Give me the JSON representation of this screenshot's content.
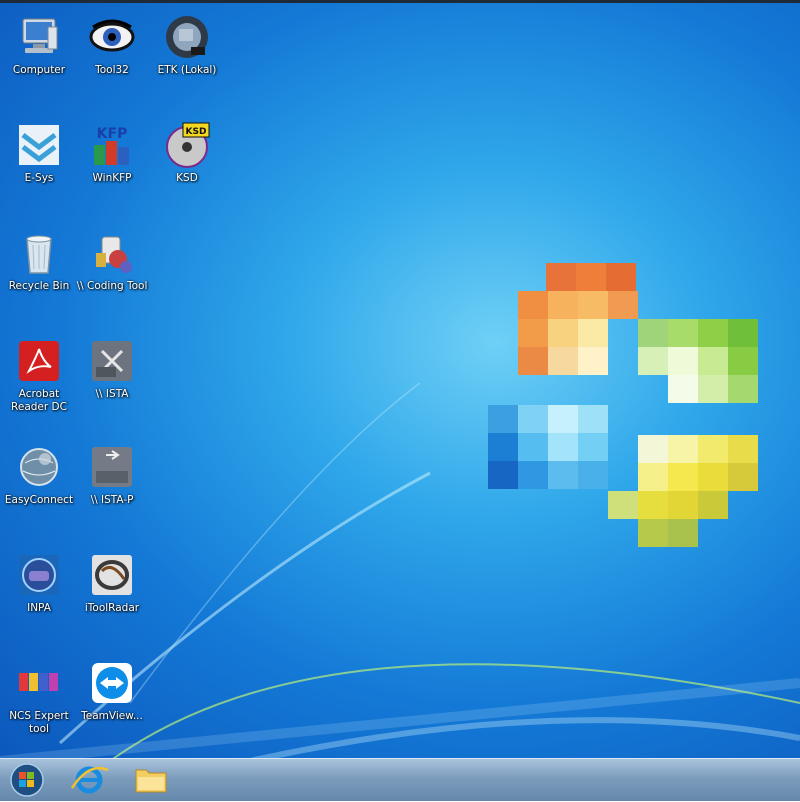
{
  "desktop": {
    "icons": [
      {
        "label": "Computer",
        "icon": "computer-icon"
      },
      {
        "label": "Tool32",
        "icon": "eye-icon"
      },
      {
        "label": "ETK (Lokal)",
        "icon": "etk-disc-icon"
      },
      {
        "label": "E-Sys",
        "icon": "esys-icon"
      },
      {
        "label": "WinKFP",
        "icon": "winkfp-icon"
      },
      {
        "label": "KSD",
        "icon": "ksd-disc-icon"
      },
      {
        "label": "Recycle Bin",
        "icon": "recycle-bin-icon"
      },
      {
        "label": "\\\\ Coding Tool",
        "icon": "coding-tool-icon"
      },
      {
        "label": "Acrobat Reader DC",
        "icon": "acrobat-icon"
      },
      {
        "label": "\\\\ ISTA",
        "icon": "ista-icon"
      },
      {
        "label": "EasyConnect",
        "icon": "globe-icon"
      },
      {
        "label": "\\\\ ISTA-P",
        "icon": "ista-p-icon"
      },
      {
        "label": "INPA",
        "icon": "inpa-icon"
      },
      {
        "label": "iToolRadar",
        "icon": "itoolradar-icon"
      },
      {
        "label": "NCS Expert tool",
        "icon": "ncs-expert-icon"
      },
      {
        "label": "TeamView...",
        "icon": "teamviewer-icon"
      }
    ]
  },
  "taskbar": {
    "items": [
      {
        "icon": "start-orb-icon"
      },
      {
        "icon": "internet-explorer-icon"
      },
      {
        "icon": "file-explorer-icon"
      }
    ]
  },
  "colors": {
    "wallpaper_blue": "#1479d6",
    "taskbar": "#7d9dbd"
  }
}
